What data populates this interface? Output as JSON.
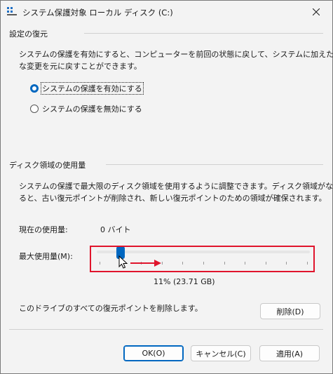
{
  "window": {
    "title": "システム保護対象 ローカル ディスク (C:)",
    "close_glyph": "✕"
  },
  "restore_settings": {
    "group_label": "設定の復元",
    "description_line1": "システムの保護を有効にすると、コンピューターを前回の状態に戻して、システムに加えた不要",
    "description_line2": "な変更を元に戻すことができます。",
    "options": [
      {
        "label": "システムの保護を有効にする",
        "checked": true
      },
      {
        "label": "システムの保護を無効にする",
        "checked": false
      }
    ]
  },
  "disk_usage": {
    "group_label": "ディスク領域の使用量",
    "description_line1": "システムの保護で最大限のディスク領域を使用するように調整できます。ディスク領域がなくな",
    "description_line2": "ると、古い復元ポイントが削除され、新しい復元ポイントのための領域が確保されます。",
    "current_usage_label": "現在の使用量:",
    "current_usage_value": "0 バイト",
    "max_usage_label": "最大使用量(M):",
    "max_usage_level": 0.11,
    "max_usage_value": "11% (23.71 GB)"
  },
  "delete_section": {
    "text": "このドライブのすべての復元ポイントを削除します。",
    "delete_button": "削除(D)"
  },
  "footer": {
    "ok_button": "OK(O)",
    "cancel_button": "キャンセル(C)",
    "apply_button": "適用(A)"
  },
  "colors": {
    "accent": "#0067c0",
    "highlight": "#e0142c"
  }
}
